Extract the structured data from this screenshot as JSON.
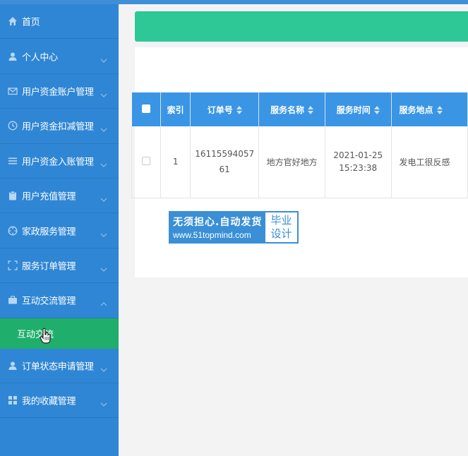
{
  "sidebar": {
    "items": [
      {
        "label": "首页",
        "icon": "home-icon",
        "chevron": ""
      },
      {
        "label": "个人中心",
        "icon": "user-icon",
        "chevron": "down"
      },
      {
        "label": "用户资金账户管理",
        "icon": "mail-icon",
        "chevron": "down"
      },
      {
        "label": "用户资金扣减管理",
        "icon": "clock-icon",
        "chevron": "down"
      },
      {
        "label": "用户资金入账管理",
        "icon": "list-icon",
        "chevron": "down"
      },
      {
        "label": "用户充值管理",
        "icon": "clipboard-icon",
        "chevron": "down"
      },
      {
        "label": "家政服务管理",
        "icon": "crosshair-icon",
        "chevron": "down"
      },
      {
        "label": "服务订单管理",
        "icon": "scan-icon",
        "chevron": "down"
      },
      {
        "label": "互动交流管理",
        "icon": "briefcase-icon",
        "chevron": "up"
      }
    ],
    "active_sub": {
      "label": "互动交流"
    },
    "items_after": [
      {
        "label": "订单状态申请管理",
        "icon": "user-icon",
        "chevron": "down"
      },
      {
        "label": "我的收藏管理",
        "icon": "grid-icon",
        "chevron": "down"
      }
    ]
  },
  "table": {
    "headers": [
      "索引",
      "订单号",
      "服务名称",
      "服务时间",
      "服务地点"
    ],
    "rows": [
      {
        "index": "1",
        "order_no_1": "16115594057",
        "order_no_2": "61",
        "service_name": "地方官好地方",
        "service_time_1": "2021-01-25",
        "service_time_2": "15:23:38",
        "service_place": "发电工很反感"
      }
    ]
  },
  "watermark": {
    "line1": "无须担心.自动发货",
    "line2": "www.51topmind.com",
    "right1": "毕业",
    "right2": "设计"
  },
  "colors": {
    "sidebar": "#2f86d4",
    "active": "#1fae6b",
    "banner": "#2dc896",
    "table_header": "#3a95e4"
  }
}
